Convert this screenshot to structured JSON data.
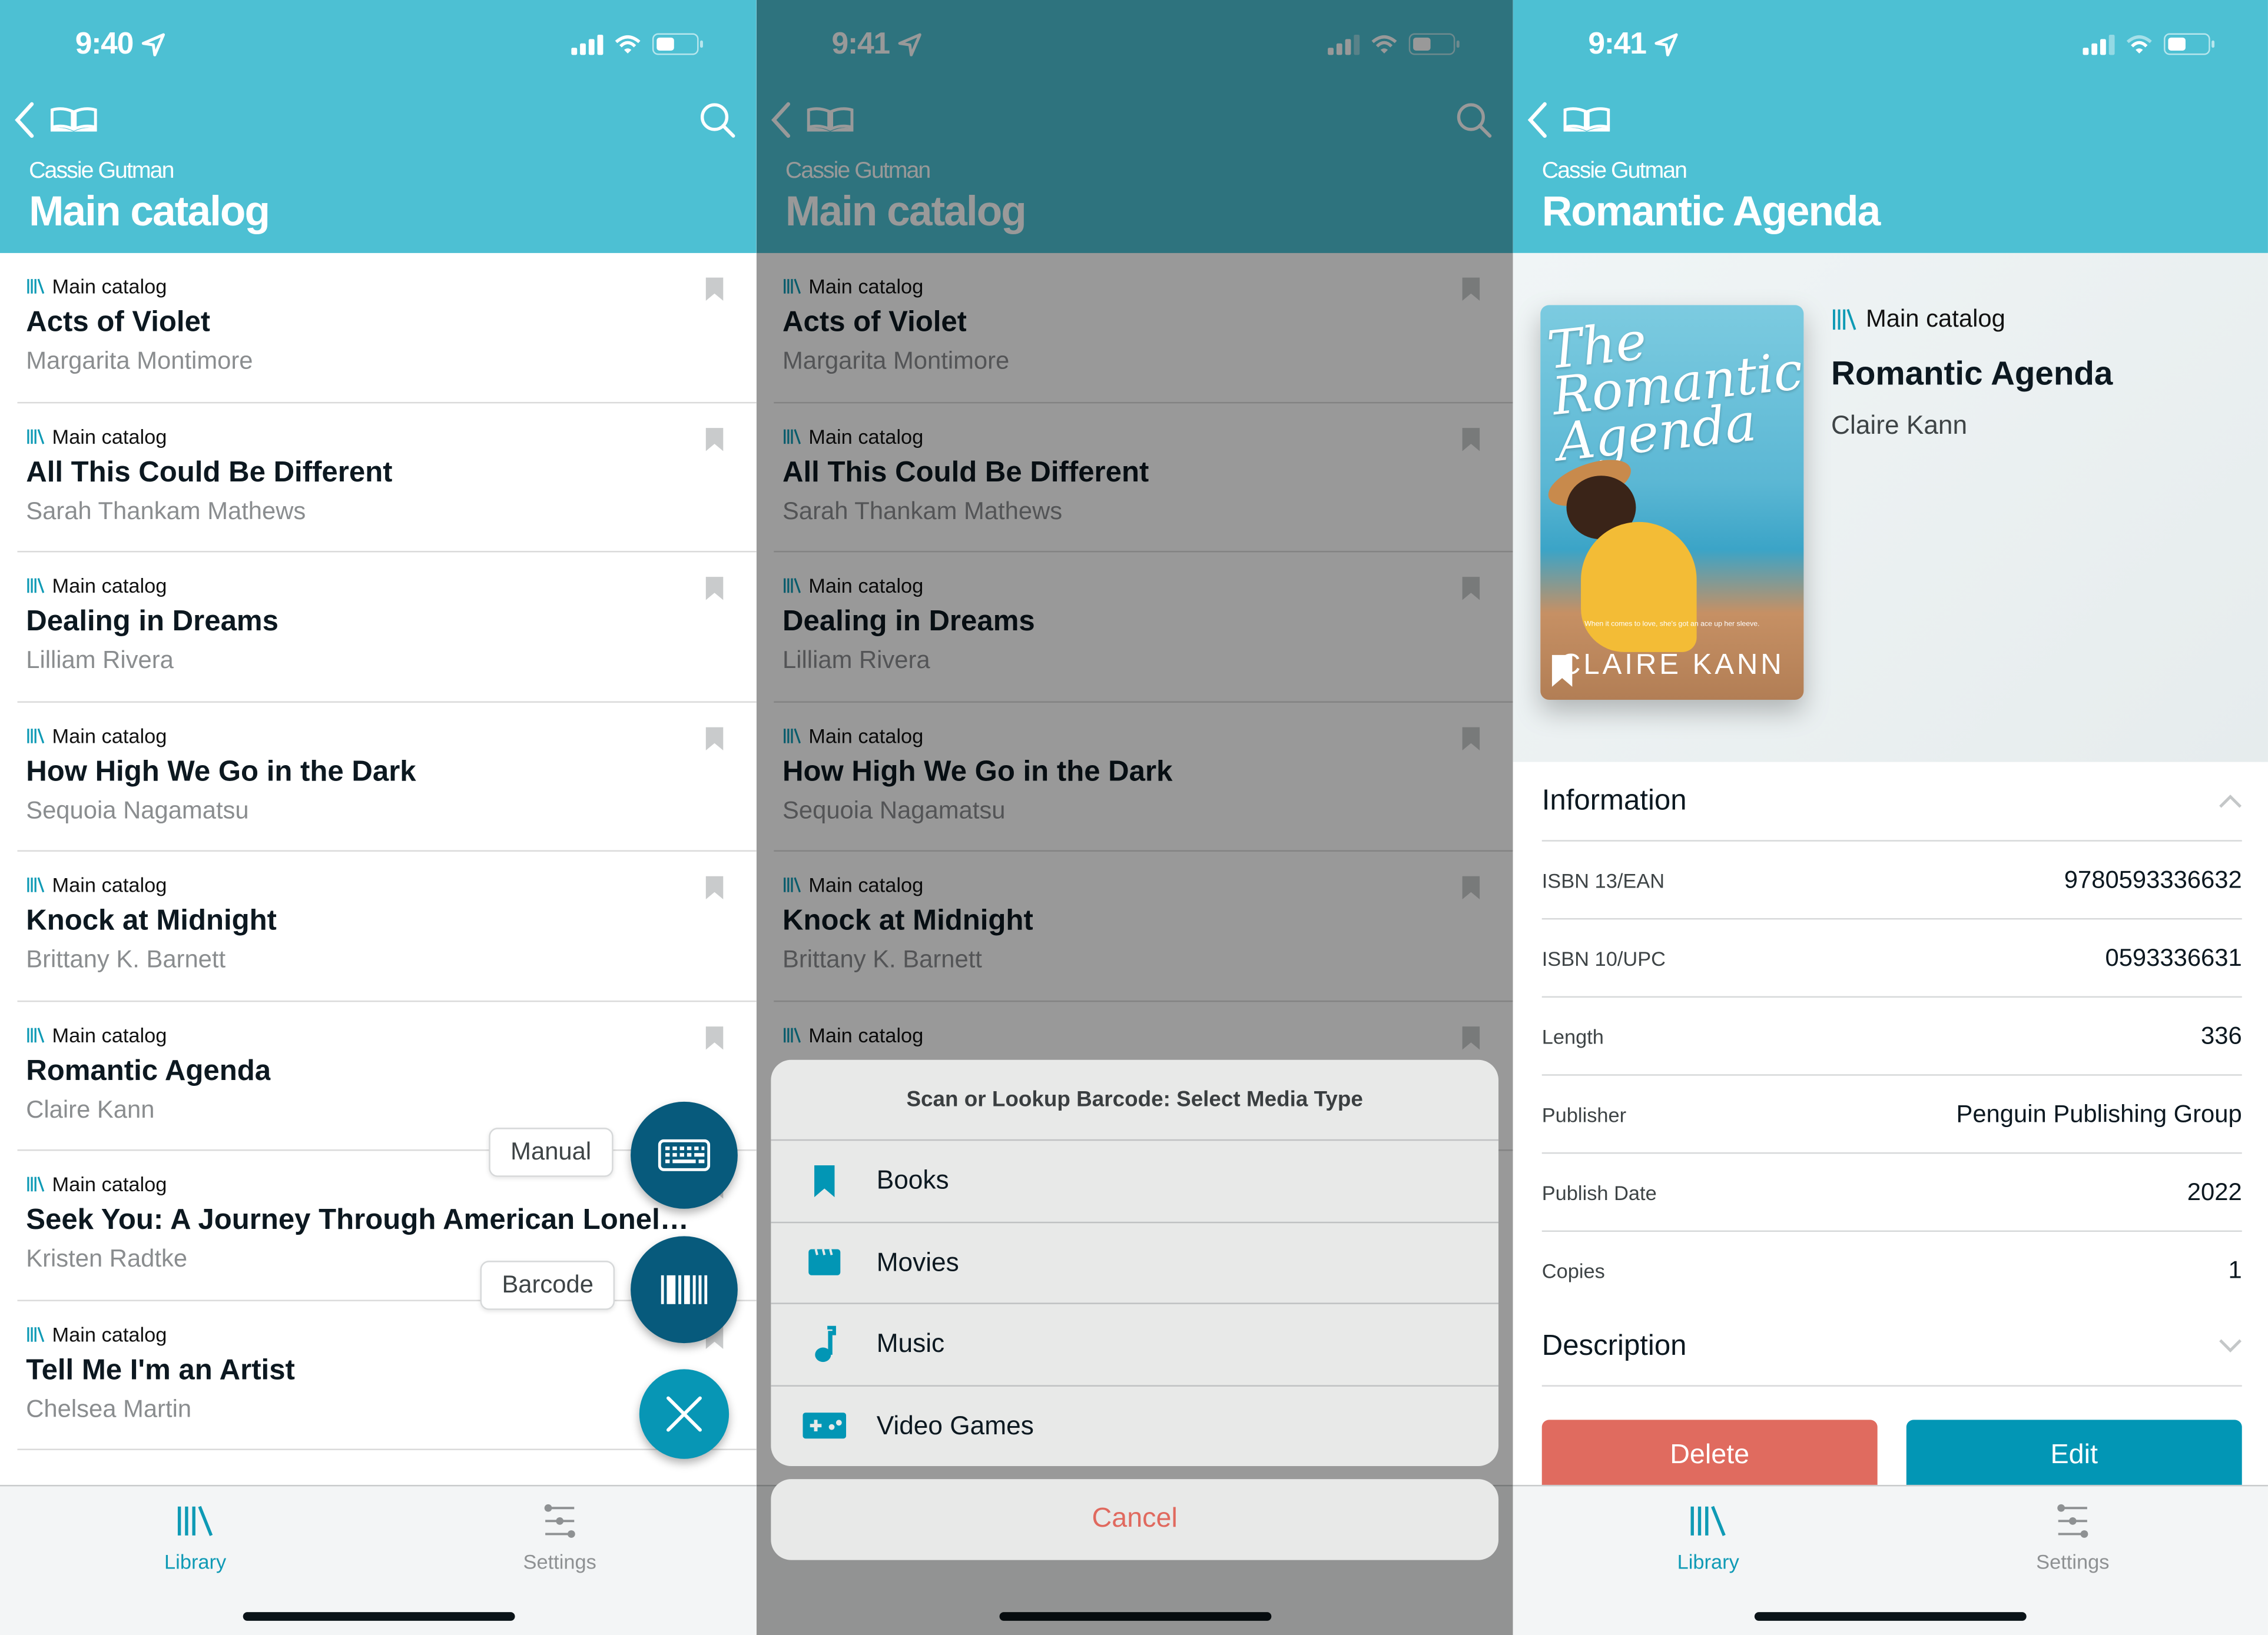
{
  "colors": {
    "header_teal": "#4dc0d3",
    "accent": "#0e9ab5",
    "fab_dark": "#075a7c",
    "fab_light": "#0796b5",
    "delete_red": "#e06b5f",
    "edit_blue": "#0296b5",
    "cancel_red": "#e0695e"
  },
  "screens": [
    {
      "status": {
        "time": "9:40"
      },
      "header": {
        "owner": "Cassie Gutman",
        "title": "Main catalog"
      },
      "items": [
        {
          "catalog": "Main catalog",
          "title": "Acts of Violet",
          "author": "Margarita Montimore"
        },
        {
          "catalog": "Main catalog",
          "title": "All This Could Be Different",
          "author": "Sarah Thankam Mathews"
        },
        {
          "catalog": "Main catalog",
          "title": "Dealing in Dreams",
          "author": "Lilliam Rivera"
        },
        {
          "catalog": "Main catalog",
          "title": "How High We Go in the Dark",
          "author": "Sequoia Nagamatsu"
        },
        {
          "catalog": "Main catalog",
          "title": "Knock at Midnight",
          "author": "Brittany K. Barnett"
        },
        {
          "catalog": "Main catalog",
          "title": "Romantic Agenda",
          "author": "Claire Kann"
        },
        {
          "catalog": "Main catalog",
          "title": "Seek You: A Journey Through American Lonelin…",
          "author": "Kristen Radtke"
        },
        {
          "catalog": "Main catalog",
          "title": "Tell Me I'm an Artist",
          "author": "Chelsea Martin"
        }
      ],
      "fab_menu": {
        "manual_label": "Manual",
        "barcode_label": "Barcode",
        "manual_icon": "keyboard-icon",
        "barcode_icon": "barcode-icon",
        "close_icon": "close-icon"
      },
      "tabs": [
        {
          "label": "Library",
          "icon": "library-icon",
          "active": true
        },
        {
          "label": "Settings",
          "icon": "sliders-icon",
          "active": false
        }
      ]
    },
    {
      "status": {
        "time": "9:41"
      },
      "header": {
        "owner": "Cassie Gutman",
        "title": "Main catalog"
      },
      "items": [
        {
          "catalog": "Main catalog",
          "title": "Acts of Violet",
          "author": "Margarita Montimore"
        },
        {
          "catalog": "Main catalog",
          "title": "All This Could Be Different",
          "author": "Sarah Thankam Mathews"
        },
        {
          "catalog": "Main catalog",
          "title": "Dealing in Dreams",
          "author": "Lilliam Rivera"
        },
        {
          "catalog": "Main catalog",
          "title": "How High We Go in the Dark",
          "author": "Sequoia Nagamatsu"
        },
        {
          "catalog": "Main catalog",
          "title": "Knock at Midnight",
          "author": "Brittany K. Barnett"
        },
        {
          "catalog": "Main catalog",
          "title": "",
          "author": ""
        }
      ],
      "action_sheet": {
        "title": "Scan or Lookup Barcode: Select Media Type",
        "options": [
          {
            "label": "Books",
            "icon": "bookmark-icon"
          },
          {
            "label": "Movies",
            "icon": "clapperboard-icon"
          },
          {
            "label": "Music",
            "icon": "music-note-icon"
          },
          {
            "label": "Video Games",
            "icon": "gamepad-icon"
          }
        ],
        "cancel_label": "Cancel"
      }
    },
    {
      "status": {
        "time": "9:41"
      },
      "header": {
        "owner": "Cassie Gutman",
        "title": "Romantic Agenda"
      },
      "book": {
        "catalog": "Main catalog",
        "title": "Romantic Agenda",
        "author": "Claire Kann",
        "cover": {
          "title_text": "The Romantic Agenda",
          "tagline": "When it comes to love, she's got an ace up her sleeve.",
          "author_text": "CLAIRE KANN"
        }
      },
      "information": {
        "heading": "Information",
        "rows": [
          {
            "key": "ISBN 13/EAN",
            "value": "9780593336632"
          },
          {
            "key": "ISBN 10/UPC",
            "value": "0593336631"
          },
          {
            "key": "Length",
            "value": "336"
          },
          {
            "key": "Publisher",
            "value": "Penguin Publishing Group"
          },
          {
            "key": "Publish Date",
            "value": "2022"
          },
          {
            "key": "Copies",
            "value": "1"
          }
        ]
      },
      "description": {
        "heading": "Description"
      },
      "buttons": {
        "delete": "Delete",
        "edit": "Edit"
      },
      "tabs": [
        {
          "label": "Library",
          "icon": "library-icon",
          "active": true
        },
        {
          "label": "Settings",
          "icon": "sliders-icon",
          "active": false
        }
      ]
    }
  ]
}
